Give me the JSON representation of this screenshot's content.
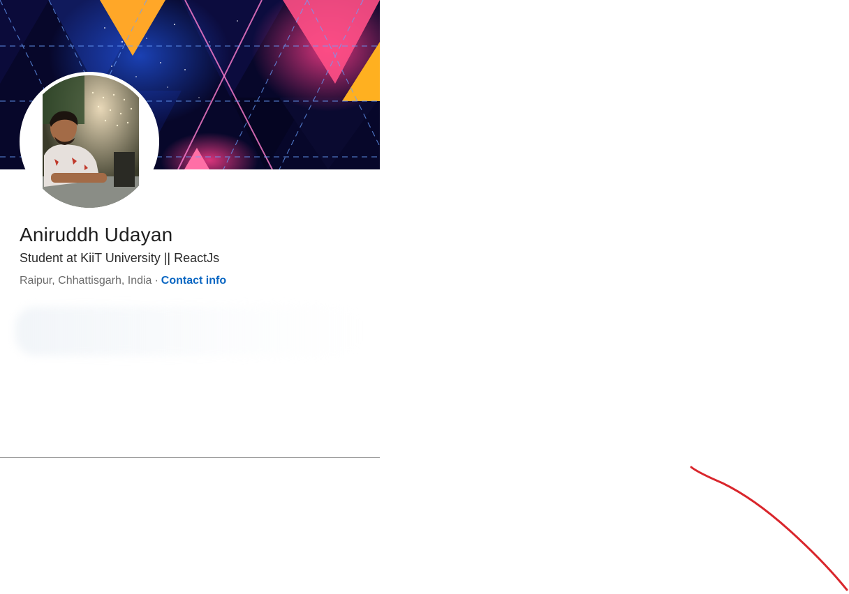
{
  "profile": {
    "name": "Aniruddh Udayan",
    "headline": "Student at KiiT University || ReactJs",
    "location": "Raipur, Chhattisgarh, India",
    "separator": "·",
    "contact_info_label": "Contact info"
  },
  "colors": {
    "link": "#0a66c2",
    "annotation_stroke": "#d9262c",
    "cover_background": "#0a0a2e"
  }
}
